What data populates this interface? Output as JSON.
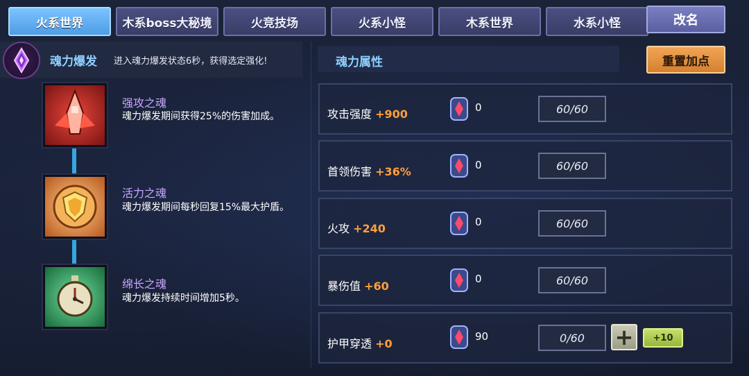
{
  "tabs": [
    {
      "label": "火系世界",
      "active": true
    },
    {
      "label": "木系boss大秘境",
      "active": false
    },
    {
      "label": "火竞技场",
      "active": false
    },
    {
      "label": "火系小怪",
      "active": false
    },
    {
      "label": "木系世界",
      "active": false
    },
    {
      "label": "水系小怪",
      "active": false
    }
  ],
  "buttons": {
    "rename": "改名",
    "reset": "重置加点",
    "plus": "+",
    "plus10": "+10"
  },
  "burst": {
    "title": "魂力爆发",
    "description": "进入魂力爆发状态6秒，获得选定强化!",
    "icon": "soul-crystal-icon"
  },
  "skills": [
    {
      "name": "强攻之魂",
      "description": "魂力爆发期间获得25%的伤害加成。",
      "icon": "red-rocket-icon"
    },
    {
      "name": "活力之魂",
      "description": "魂力爆发期间每秒回复15%最大护盾。",
      "icon": "gold-shield-icon"
    },
    {
      "name": "绵长之魂",
      "description": "魂力爆发持续时间增加5秒。",
      "icon": "green-clock-icon"
    }
  ],
  "attributes": {
    "title": "魂力属性",
    "rows": [
      {
        "label": "攻击强度",
        "bonus": "+900",
        "count": "0",
        "cap": "60/60"
      },
      {
        "label": "首领伤害",
        "bonus": "+36%",
        "count": "0",
        "cap": "60/60"
      },
      {
        "label": "火攻",
        "bonus": "+240",
        "count": "0",
        "cap": "60/60"
      },
      {
        "label": "暴伤值",
        "bonus": "+60",
        "count": "0",
        "cap": "60/60"
      },
      {
        "label": "护甲穿透",
        "bonus": "+0",
        "count": "90",
        "cap": "0/60"
      }
    ]
  },
  "colors": {
    "accent_blue": "#8ed1ff",
    "bonus_orange": "#ff9f3a",
    "skill_purple": "#c7a6ff",
    "reset_orange": "#d4802f",
    "plus10_green": "#98b63c"
  }
}
